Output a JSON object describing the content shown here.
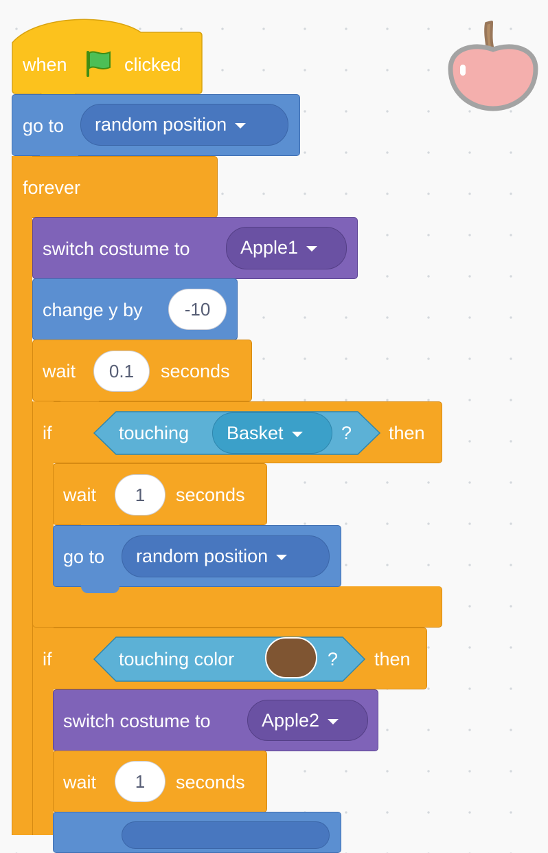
{
  "script": {
    "hat": {
      "when": "when",
      "clicked": "clicked",
      "flag_icon": "green-flag-icon"
    },
    "goto1": {
      "label": "go to",
      "dropdown": "random position"
    },
    "forever": {
      "label": "forever"
    },
    "costume1": {
      "label": "switch costume to",
      "dropdown": "Apple1"
    },
    "change_y": {
      "label": "change y by",
      "value": "-10"
    },
    "wait1": {
      "label": "wait",
      "value": "0.1",
      "unit": "seconds"
    },
    "if1": {
      "if": "if",
      "then": "then",
      "condition": {
        "label": "touching",
        "dropdown": "Basket",
        "q": "?"
      },
      "wait": {
        "label": "wait",
        "value": "1",
        "unit": "seconds"
      },
      "goto": {
        "label": "go to",
        "dropdown": "random position"
      }
    },
    "if2": {
      "if": "if",
      "then": "then",
      "condition": {
        "label": "touching color",
        "q": "?",
        "color": "#7f5532"
      },
      "costume": {
        "label": "switch costume to",
        "dropdown": "Apple2"
      },
      "wait": {
        "label": "wait",
        "value": "1",
        "unit": "seconds"
      }
    }
  },
  "sprite": {
    "icon": "apple-sprite-icon"
  },
  "colors": {
    "events": "#fcc21d",
    "motion": "#5b8fd1",
    "looks": "#7f63b8",
    "control": "#f6a623",
    "sensing": "#5cb1d6"
  }
}
